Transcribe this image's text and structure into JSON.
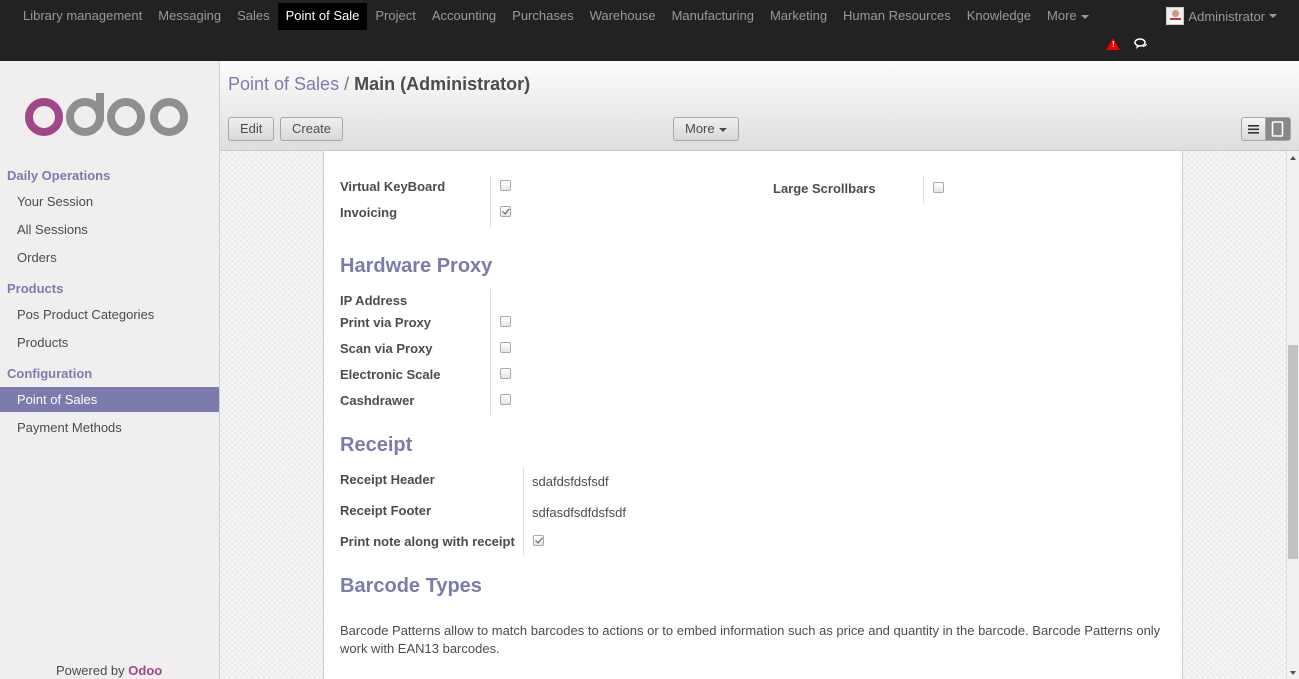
{
  "topbar": {
    "menu": [
      "Library management",
      "Messaging",
      "Sales",
      "Point of Sale",
      "Project",
      "Accounting",
      "Purchases",
      "Warehouse",
      "Manufacturing",
      "Marketing",
      "Human Resources",
      "Knowledge",
      "More"
    ],
    "active_menu": "Point of Sale",
    "user": "Administrator"
  },
  "sidebar": {
    "sections": [
      {
        "title": "Daily Operations",
        "items": [
          "Your Session",
          "All Sessions",
          "Orders"
        ]
      },
      {
        "title": "Products",
        "items": [
          "Pos Product Categories",
          "Products"
        ]
      },
      {
        "title": "Configuration",
        "items": [
          "Point of Sales",
          "Payment Methods"
        ]
      }
    ],
    "active_item": "Point of Sales",
    "powered_prefix": "Powered by",
    "powered_brand": "Odoo"
  },
  "control": {
    "breadcrumb_parent": "Point of Sales",
    "breadcrumb_sep": "/",
    "breadcrumb_current": "Main (Administrator)",
    "edit_label": "Edit",
    "create_label": "Create",
    "more_label": "More"
  },
  "form": {
    "virtual_keyboard_label": "Virtual KeyBoard",
    "virtual_keyboard": false,
    "invoicing_label": "Invoicing",
    "invoicing": true,
    "large_scrollbars_label": "Large Scrollbars",
    "large_scrollbars": false,
    "hardware_title": "Hardware Proxy",
    "ip_label": "IP Address",
    "print_proxy_label": "Print via Proxy",
    "scan_proxy_label": "Scan via Proxy",
    "scale_label": "Electronic Scale",
    "cashdrawer_label": "Cashdrawer",
    "receipt_title": "Receipt",
    "receipt_header_label": "Receipt Header",
    "receipt_header_value": "sdafdsfdsfsdf",
    "receipt_footer_label": "Receipt Footer",
    "receipt_footer_value": "sdfasdfsdfdsfsdf",
    "print_note_label": "Print note along with receipt",
    "print_note": true,
    "barcode_title": "Barcode Types",
    "barcode_text": "Barcode Patterns allow to match barcodes to actions or to embed information such as price and quantity in the barcode. Barcode Patterns only work with EAN13 barcodes."
  },
  "colors": {
    "accent": "#7c7bad",
    "brand": "#a24689",
    "topbar": "#222222"
  }
}
